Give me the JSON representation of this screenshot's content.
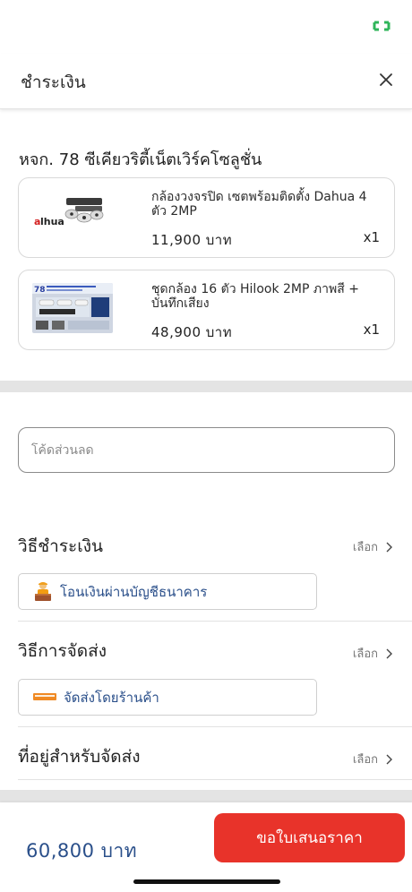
{
  "header": {
    "title": "ชำระเงิน",
    "close_icon": "close-icon"
  },
  "shop": {
    "name": "หจก. 78 ซีเคียวริตี้เน็ตเวิร์คโซลูชั่น"
  },
  "products": [
    {
      "name": "กล้องวงจรปิด เซตพร้อมติดตั้ง Dahua 4 ตัว  2MP",
      "price": "11,900 บาท",
      "qty": "x1",
      "thumb_brand": "alhua"
    },
    {
      "name": "ชุดกล้อง 16 ตัว Hilook 2MP ภาพสี + บันทึกเสียง",
      "price": "48,900 บาท",
      "qty": "x1",
      "thumb_brand": "78"
    }
  ],
  "coupon": {
    "placeholder": "โค้ดส่วนลด",
    "value": ""
  },
  "payment": {
    "title": "วิธีชำระเงิน",
    "select_label": "เลือก",
    "option_label": "โอนเงินผ่านบัญชีธนาคาร",
    "option_icon": "delivery-person-icon"
  },
  "shipping": {
    "title": "วิธีการจัดส่ง",
    "select_label": "เลือก",
    "option_label": "จัดส่งโดยร้านค้า",
    "option_icon": "store-shipping-icon"
  },
  "address": {
    "title": "ที่อยู่สำหรับจัดส่ง",
    "select_label": "เลือก"
  },
  "footer": {
    "total": "60,800 บาท",
    "quote_button": "ขอใบเสนอราคา"
  },
  "colors": {
    "accent_blue": "#2a4f8a",
    "button_red": "#e8332a",
    "battery_green": "#2fb55a"
  }
}
